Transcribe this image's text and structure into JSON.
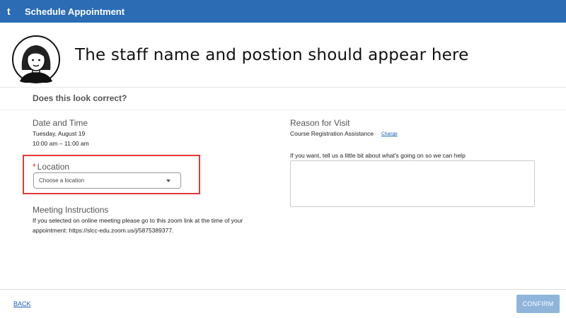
{
  "header": {
    "logo": "t",
    "title": "Schedule Appointment",
    "bar_color": "#2b6cb5"
  },
  "staff": {
    "avatar_icon": "user-avatar-icon",
    "name_position": "The staff name and postion should appear here"
  },
  "confirm_question": "Does this look correct?",
  "date_time": {
    "label": "Date and Time",
    "date": "Tuesday, August 19",
    "time": "10:00 am – 11:00 am"
  },
  "location": {
    "required_mark": "*",
    "label": "Location",
    "placeholder": "Choose a location",
    "highlight_color": "#e53935"
  },
  "meeting": {
    "label": "Meeting Instructions",
    "line1": "If you selected on online meeting please go to this zoom link at the time of your",
    "line2": "appointment: https://slcc-edu.zoom.us/j/5875389377."
  },
  "reason": {
    "label": "Reason for Visit",
    "value": "Course Registration Assistance",
    "change_link": "Change",
    "help_text": "If you want, tell us a little bit about what's going on so we can help",
    "textarea_value": ""
  },
  "footer": {
    "back": "BACK",
    "confirm": "CONFIRM",
    "confirm_color": "#8fb5db"
  }
}
